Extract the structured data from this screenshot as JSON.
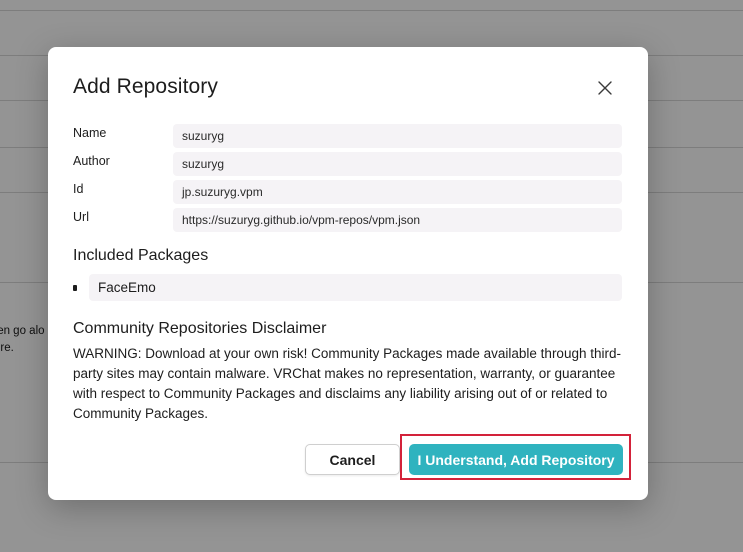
{
  "background": {
    "truncated_lines": [
      "ten go alo",
      "ere."
    ]
  },
  "dialog": {
    "title": "Add Repository",
    "close_icon": "close-icon",
    "fields": [
      {
        "label": "Name",
        "value": "suzuryg"
      },
      {
        "label": "Author",
        "value": "suzuryg"
      },
      {
        "label": "Id",
        "value": "jp.suzuryg.vpm"
      },
      {
        "label": "Url",
        "value": "https://suzuryg.github.io/vpm-repos/vpm.json"
      }
    ],
    "packages_heading": "Included Packages",
    "packages": [
      "FaceEmo"
    ],
    "disclaimer_heading": "Community Repositories Disclaimer",
    "disclaimer_text": "WARNING: Download at your own risk! Community Packages made available through third-party sites may contain malware. VRChat makes no representation, warranty, or guarantee with respect to Community Packages and disclaims any liability arising out of or related to Community Packages.",
    "cancel_label": "Cancel",
    "confirm_label": "I Understand, Add Repository"
  },
  "colors": {
    "accent": "#2fb3bf",
    "highlight": "#d3223a",
    "field_bg": "#f5f3f6"
  }
}
